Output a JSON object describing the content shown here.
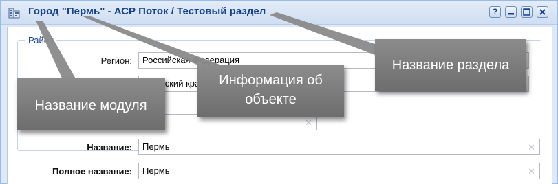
{
  "window": {
    "title": "Город \"Пермь\" - АСР Поток / Тестовый раздел",
    "buttons": {
      "help_label": "?",
      "minimize_icon": "minimize-icon",
      "maximize_icon": "maximize-icon",
      "close_icon": "close-icon"
    }
  },
  "form": {
    "group_legend": "Район",
    "region_label": "Регион:",
    "region_value": "Российская Федерация",
    "district_value": "Пермский край",
    "third_value": "",
    "name_label": "Название:",
    "name_value": "Пермь",
    "fullname_label": "Полное название:",
    "fullname_value": "Пермь",
    "clear_glyph": "✕"
  },
  "annotations": {
    "module_name": "Название модуля",
    "object_info": "Информация об объекте",
    "section_name": "Название раздела"
  },
  "colors": {
    "title_text": "#15428b",
    "callout_bg": "#7a7a7a",
    "window_border": "#99bbe8"
  }
}
